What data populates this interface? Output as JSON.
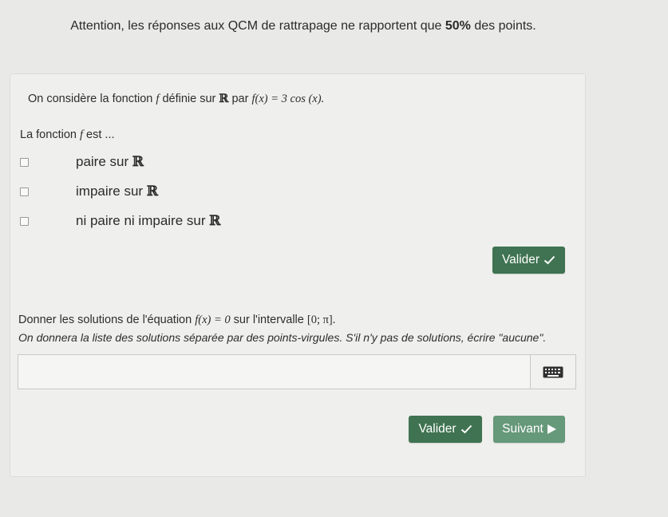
{
  "warning": {
    "before": "Attention, les réponses aux QCM de rattrapage ne rapportent que ",
    "bold": "50%",
    "after": " des points."
  },
  "question1": {
    "text_start": "On considère la fonction ",
    "var_f": "f",
    "text_defined": " définie sur ",
    "set_R": "ℝ",
    "text_par": " par ",
    "formula": "f(x) = 3 cos (x).",
    "lead_start": "La fonction ",
    "lead_f": "f",
    "lead_end": " est ...",
    "choices": [
      {
        "label": "paire sur ",
        "set": "ℝ"
      },
      {
        "label": "impaire sur ",
        "set": "ℝ"
      },
      {
        "label": "ni paire ni impaire sur ",
        "set": "ℝ"
      }
    ],
    "validate_label": "Valider"
  },
  "question2": {
    "text_start": "Donner les solutions de l'équation ",
    "equation": "f(x) = 0",
    "text_mid": " sur l'intervalle ",
    "interval": "[0; π].",
    "hint": "On donnera la liste des solutions séparée par des points-virgules. S'il n'y pas de solutions, écrire \"aucune\".",
    "answer_value": "",
    "validate_label": "Valider",
    "next_label": "Suivant"
  },
  "icons": {
    "check": "check-icon",
    "next": "play-triangle-icon",
    "keyboard": "keyboard-icon"
  },
  "colors": {
    "button_dark": "#3f7351",
    "button_light": "#66987a",
    "background": "#e9e9e7"
  }
}
